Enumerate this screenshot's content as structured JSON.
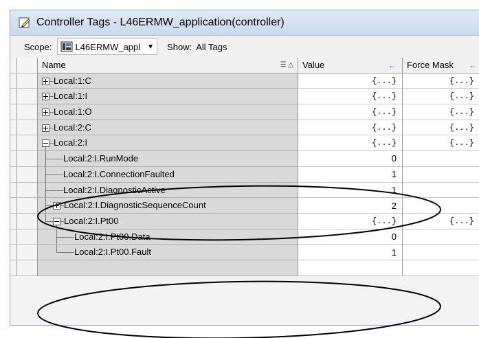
{
  "window": {
    "title": "Controller Tags - L46ERMW_application(controller)"
  },
  "scopebar": {
    "scope_label": "Scope:",
    "scope_value": "L46ERMW_appl",
    "show_label": "Show:",
    "show_value": "All Tags"
  },
  "columns": {
    "name": "Name",
    "value": "Value",
    "force_mask": "Force Mask"
  },
  "rows": [
    {
      "name": "Local:1:C",
      "value": "{...}",
      "force": "{...}"
    },
    {
      "name": "Local:1:I",
      "value": "{...}",
      "force": "{...}"
    },
    {
      "name": "Local:1:O",
      "value": "{...}",
      "force": "{...}"
    },
    {
      "name": "Local:2:C",
      "value": "{...}",
      "force": "{...}"
    },
    {
      "name": "Local:2:I",
      "value": "{...}",
      "force": "{...}"
    },
    {
      "name": "Local:2:I.RunMode",
      "value": "0",
      "force": ""
    },
    {
      "name": "Local:2:I.ConnectionFaulted",
      "value": "1",
      "force": ""
    },
    {
      "name": "Local:2:I.DiagnosticActive",
      "value": "1",
      "force": ""
    },
    {
      "name": "Local:2:I.DiagnosticSequenceCount",
      "value": "2",
      "force": ""
    },
    {
      "name": "Local:2:I.Pt00",
      "value": "{...}",
      "force": "{...}"
    },
    {
      "name": "Local:2:I.Pt00.Data",
      "value": "0",
      "force": ""
    },
    {
      "name": "Local:2:I.Pt00.Fault",
      "value": "1",
      "force": ""
    }
  ]
}
